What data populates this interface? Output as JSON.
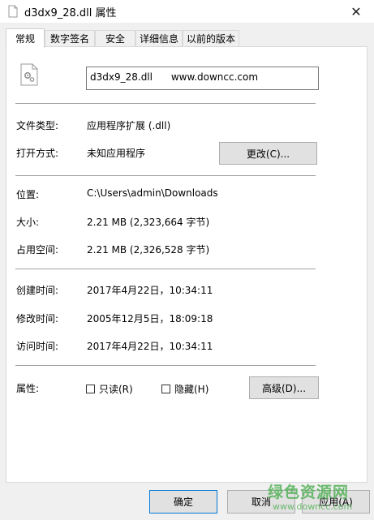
{
  "window": {
    "title": "d3dx9_28.dll 属性",
    "close_glyph": "✕"
  },
  "tabs": [
    {
      "label": "常规"
    },
    {
      "label": "数字签名"
    },
    {
      "label": "安全"
    },
    {
      "label": "详细信息"
    },
    {
      "label": "以前的版本"
    }
  ],
  "file": {
    "name_value": "d3dx9_28.dll      www.downcc.com"
  },
  "props": {
    "type_label": "文件类型:",
    "type_value": "应用程序扩展 (.dll)",
    "open_label": "打开方式:",
    "open_value": "未知应用程序",
    "change_button": "更改(C)...",
    "location_label": "位置:",
    "location_value": "C:\\Users\\admin\\Downloads",
    "size_label": "大小:",
    "size_value": "2.21 MB (2,323,664 字节)",
    "disk_label": "占用空间:",
    "disk_value": "2.21 MB (2,326,528 字节)",
    "created_label": "创建时间:",
    "created_value": "2017年4月22日，10:34:11",
    "modified_label": "修改时间:",
    "modified_value": "2005年12月5日，18:09:18",
    "accessed_label": "访问时间:",
    "accessed_value": "2017年4月22日，10:34:11",
    "attr_label": "属性:",
    "readonly_label": "只读(R)",
    "hidden_label": "隐藏(H)",
    "advanced_button": "高级(D)..."
  },
  "buttons": {
    "ok": "确定",
    "cancel": "取消",
    "apply": "应用(A)"
  },
  "watermark": {
    "main": "绿色资源网",
    "sub": "www.downcc.com"
  }
}
